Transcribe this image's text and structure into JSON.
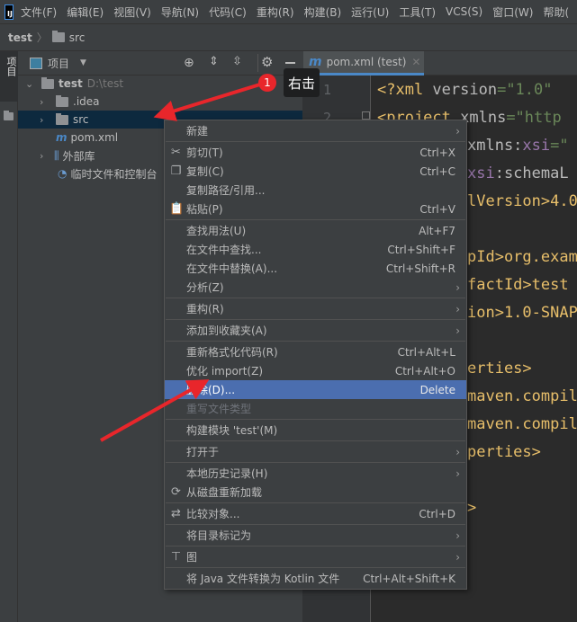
{
  "menubar": {
    "items": [
      "文件(F)",
      "编辑(E)",
      "视图(V)",
      "导航(N)",
      "代码(C)",
      "重构(R)",
      "构建(B)",
      "运行(U)",
      "工具(T)",
      "VCS(S)",
      "窗口(W)",
      "帮助("
    ]
  },
  "breadcrumb": {
    "root": "test",
    "child": "src"
  },
  "left_strip": {
    "label": "项目"
  },
  "project_panel": {
    "title": "项目"
  },
  "tree": {
    "root": {
      "name": "test",
      "path": "D:\\test"
    },
    "idea": ".idea",
    "src": "src",
    "pom": "pom.xml",
    "ext": "外部库",
    "scratch": "临时文件和控制台"
  },
  "editor": {
    "tab": "pom.xml (test)",
    "line_numbers": [
      "1",
      "2"
    ]
  },
  "code": {
    "l1": [
      "<?xml ",
      "version",
      "=\"1.0\" "
    ],
    "l2": [
      "<project ",
      "xmlns",
      "=\"http"
    ],
    "l3": [
      "xmlns:",
      "xsi",
      "=\""
    ],
    "l4": [
      "xsi",
      ":schemaL"
    ],
    "l5": "lVersion>4.0",
    "l7": "pId>org.exam",
    "l8": "factId>test",
    "l9": "ion>1.0-SNAP",
    "l11": "erties>",
    "l12": "maven.compil",
    "l13": "maven.compil",
    "l14": "perties>",
    "l16": ">"
  },
  "annotation": {
    "badge": "1",
    "tooltip": "右击",
    "arrow_color": "#e8262b"
  },
  "context_menu": {
    "items": [
      {
        "label": "新建",
        "submenu": true
      },
      {
        "label": "剪切(T)",
        "shortcut": "Ctrl+X",
        "icon": "scissors-icon"
      },
      {
        "label": "复制(C)",
        "shortcut": "Ctrl+C",
        "icon": "copy-icon"
      },
      {
        "label": "复制路径/引用..."
      },
      {
        "label": "粘贴(P)",
        "shortcut": "Ctrl+V",
        "icon": "paste-icon"
      },
      {
        "label": "查找用法(U)",
        "shortcut": "Alt+F7"
      },
      {
        "label": "在文件中查找...",
        "shortcut": "Ctrl+Shift+F"
      },
      {
        "label": "在文件中替换(A)...",
        "shortcut": "Ctrl+Shift+R"
      },
      {
        "label": "分析(Z)",
        "submenu": true
      },
      {
        "label": "重构(R)",
        "submenu": true
      },
      {
        "label": "添加到收藏夹(A)",
        "submenu": true
      },
      {
        "label": "重新格式化代码(R)",
        "shortcut": "Ctrl+Alt+L"
      },
      {
        "label": "优化 import(Z)",
        "shortcut": "Ctrl+Alt+O"
      },
      {
        "label": "删除(D)...",
        "shortcut": "Delete",
        "highlighted": true
      },
      {
        "label": "重写文件类型",
        "disabled": true
      },
      {
        "label": "构建模块 'test'(M)"
      },
      {
        "label": "打开于",
        "submenu": true
      },
      {
        "label": "本地历史记录(H)",
        "submenu": true
      },
      {
        "label": "从磁盘重新加载",
        "icon": "reload-icon"
      },
      {
        "label": "比较对象...",
        "shortcut": "Ctrl+D",
        "icon": "compare-icon"
      },
      {
        "label": "将目录标记为",
        "submenu": true
      },
      {
        "label": "图",
        "submenu": true,
        "icon": "diagram-icon"
      },
      {
        "label": "将 Java 文件转换为 Kotlin 文件",
        "shortcut": "Ctrl+Alt+Shift+K"
      }
    ]
  },
  "colors": {
    "highlight": "#4b6eaf",
    "accent": "#4a88c7"
  }
}
